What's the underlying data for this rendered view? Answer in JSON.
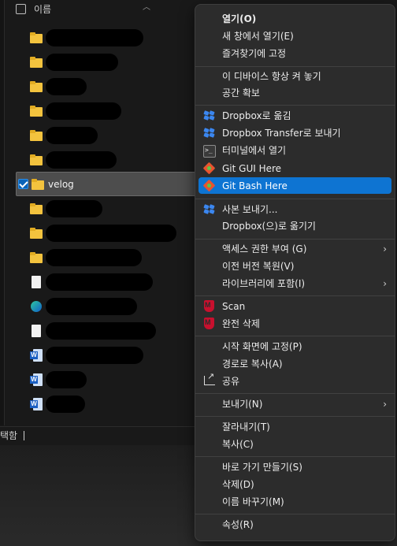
{
  "explorer": {
    "column_header": "이름",
    "selected_item": "velog",
    "status_text": "택함",
    "rows": [
      {
        "type": "folder",
        "redact_width": 124
      },
      {
        "type": "folder",
        "redact_width": 92
      },
      {
        "type": "folder",
        "redact_width": 52
      },
      {
        "type": "folder",
        "redact_width": 96
      },
      {
        "type": "folder",
        "redact_width": 66
      },
      {
        "type": "folder",
        "redact_width": 90
      },
      {
        "type": "folder-selected",
        "label": "velog"
      },
      {
        "type": "folder",
        "redact_width": 72
      },
      {
        "type": "folder",
        "redact_width": 166
      },
      {
        "type": "folder",
        "redact_width": 122
      },
      {
        "type": "doc",
        "redact_width": 136
      },
      {
        "type": "edge",
        "redact_width": 116
      },
      {
        "type": "doc",
        "redact_width": 140
      },
      {
        "type": "word",
        "redact_width": 124
      },
      {
        "type": "word",
        "redact_width": 52
      },
      {
        "type": "word",
        "redact_width": 50
      }
    ]
  },
  "context_menu": {
    "items": [
      {
        "label": "열기(O)",
        "bold": true
      },
      {
        "label": "새 창에서 열기(E)"
      },
      {
        "label": "즐겨찾기에 고정"
      },
      {
        "label": "이 디바이스 항상 켜 놓기"
      },
      {
        "label": "공간 확보"
      },
      {
        "label": "Dropbox로 옮김",
        "icon": "dropbox-icon"
      },
      {
        "label": "Dropbox Transfer로 보내기",
        "icon": "dropbox-icon"
      },
      {
        "label": "터미널에서 열기",
        "icon": "terminal-icon"
      },
      {
        "label": "Git GUI Here",
        "icon": "git-gui-icon"
      },
      {
        "label": "Git Bash Here",
        "icon": "git-bash-icon",
        "highlighted": true
      },
      {
        "label": "사본 보내기...",
        "icon": "dropbox-icon"
      },
      {
        "label": "Dropbox(으)로 옮기기"
      },
      {
        "label": "액세스 권한 부여 (G)",
        "submenu": true
      },
      {
        "label": "이전 버전 복원(V)"
      },
      {
        "label": "라이브러리에 포함(I)",
        "submenu": true
      },
      {
        "label": "Scan",
        "icon": "mcafee-icon"
      },
      {
        "label": "완전 삭제",
        "icon": "mcafee-icon"
      },
      {
        "label": "시작 화면에 고정(P)"
      },
      {
        "label": "경로로 복사(A)"
      },
      {
        "label": "공유",
        "icon": "share-icon"
      },
      {
        "label": "보내기(N)",
        "submenu": true
      },
      {
        "label": "잘라내기(T)"
      },
      {
        "label": "복사(C)"
      },
      {
        "label": "바로 가기 만들기(S)"
      },
      {
        "label": "삭제(D)"
      },
      {
        "label": "이름 바꾸기(M)"
      },
      {
        "label": "속성(R)"
      }
    ]
  },
  "colors": {
    "highlight": "#0e74d2",
    "menu_bg": "#2c2c2c",
    "folder": "#f3c33e",
    "dropbox": "#3b87f0",
    "mcafee": "#c8102e"
  }
}
